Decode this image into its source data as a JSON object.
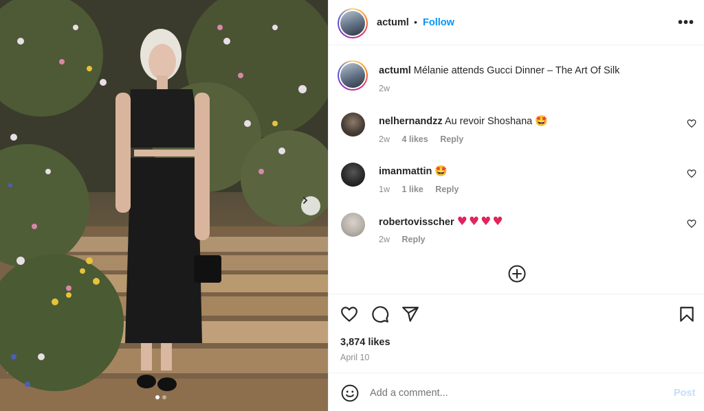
{
  "post_image": {
    "description_icon": "photo",
    "carousel_position": 1,
    "carousel_total": 2
  },
  "header": {
    "username": "actuml",
    "separator": "•",
    "follow_label": "Follow",
    "more_label": "•••"
  },
  "caption": {
    "username": "actuml",
    "text": "Mélanie attends Gucci Dinner – The Art Of Silk",
    "time": "2w"
  },
  "comments": [
    {
      "username": "nelhernandzz",
      "text": "Au revoir Shoshana",
      "emoji": "🤩",
      "time": "2w",
      "likes": "4 likes",
      "reply": "Reply"
    },
    {
      "username": "imanmattin",
      "text": "",
      "emoji": "🤩",
      "time": "1w",
      "likes": "1 like",
      "reply": "Reply"
    },
    {
      "username": "robertovisscher",
      "text": "",
      "emoji": "♥♥♥♥",
      "time": "2w",
      "likes": "",
      "reply": "Reply"
    }
  ],
  "actions": {
    "likes": "3,874 likes",
    "date": "April 10"
  },
  "comment_box": {
    "placeholder": "Add a comment...",
    "post_label": "Post"
  },
  "colors": {
    "accent": "#0095f6",
    "post_disabled": "#c0dffd",
    "muted": "#8e8e8e",
    "heart_red": "#e0245e"
  }
}
